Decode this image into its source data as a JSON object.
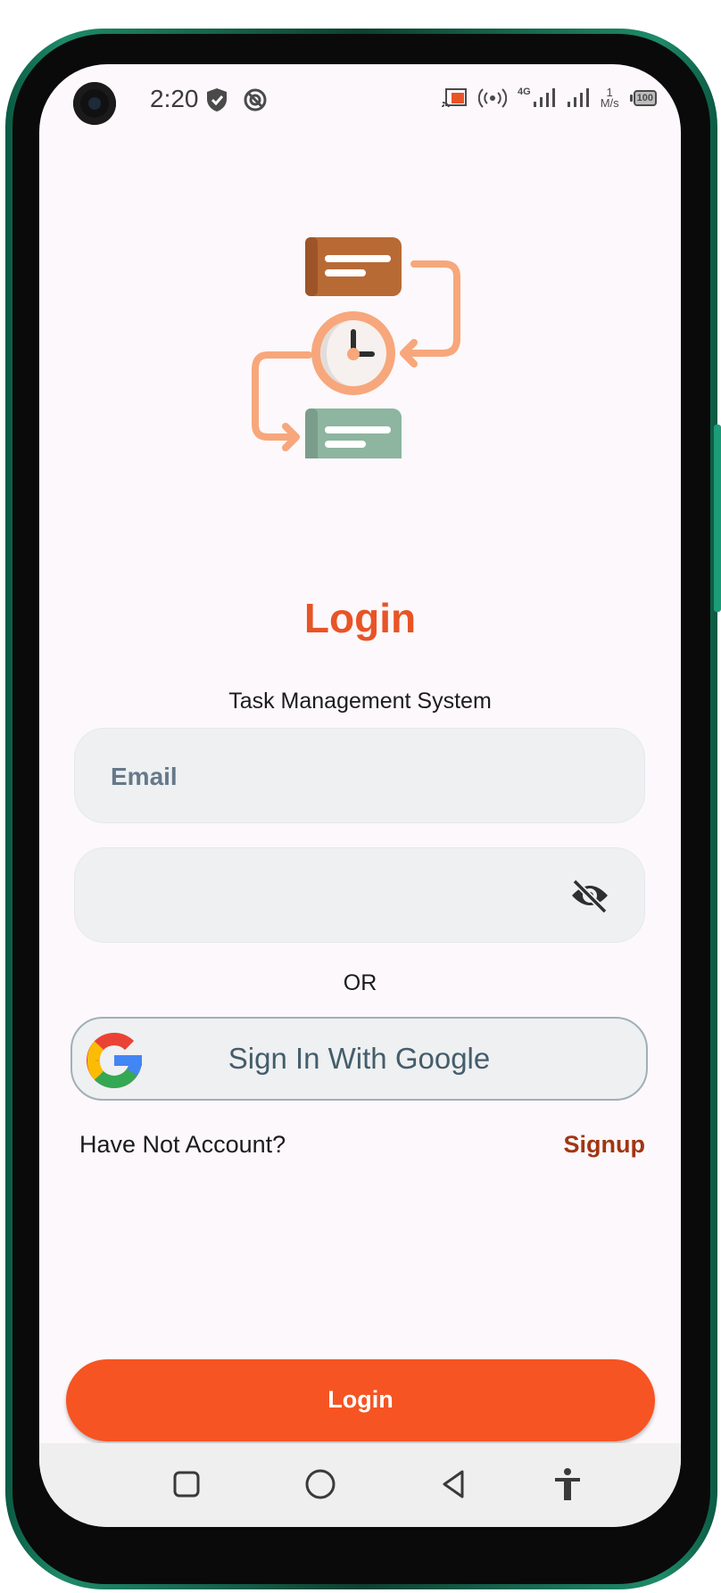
{
  "status_bar": {
    "time": "2:20",
    "network_type": "4G",
    "speed_value": "1",
    "speed_unit": "M/s",
    "battery": "100"
  },
  "login": {
    "title": "Login",
    "subtitle": "Task Management System",
    "email_placeholder": "Email",
    "password_placeholder": "",
    "or_label": "OR",
    "google_label": "Sign In With Google",
    "no_account_label": "Have Not Account?",
    "signup_label": "Signup",
    "login_button_label": "Login"
  },
  "colors": {
    "accent": "#f65422",
    "title": "#e85426",
    "signup": "#a03612",
    "field_bg": "#eef0f1",
    "screen_bg": "#fcf8fb"
  },
  "icons": {
    "illustration": "task-flow-illustration",
    "password_toggle": "eye-off-icon",
    "google": "google-logo-icon",
    "nav": [
      "recent-apps-icon",
      "home-icon",
      "back-icon",
      "accessibility-icon"
    ]
  }
}
